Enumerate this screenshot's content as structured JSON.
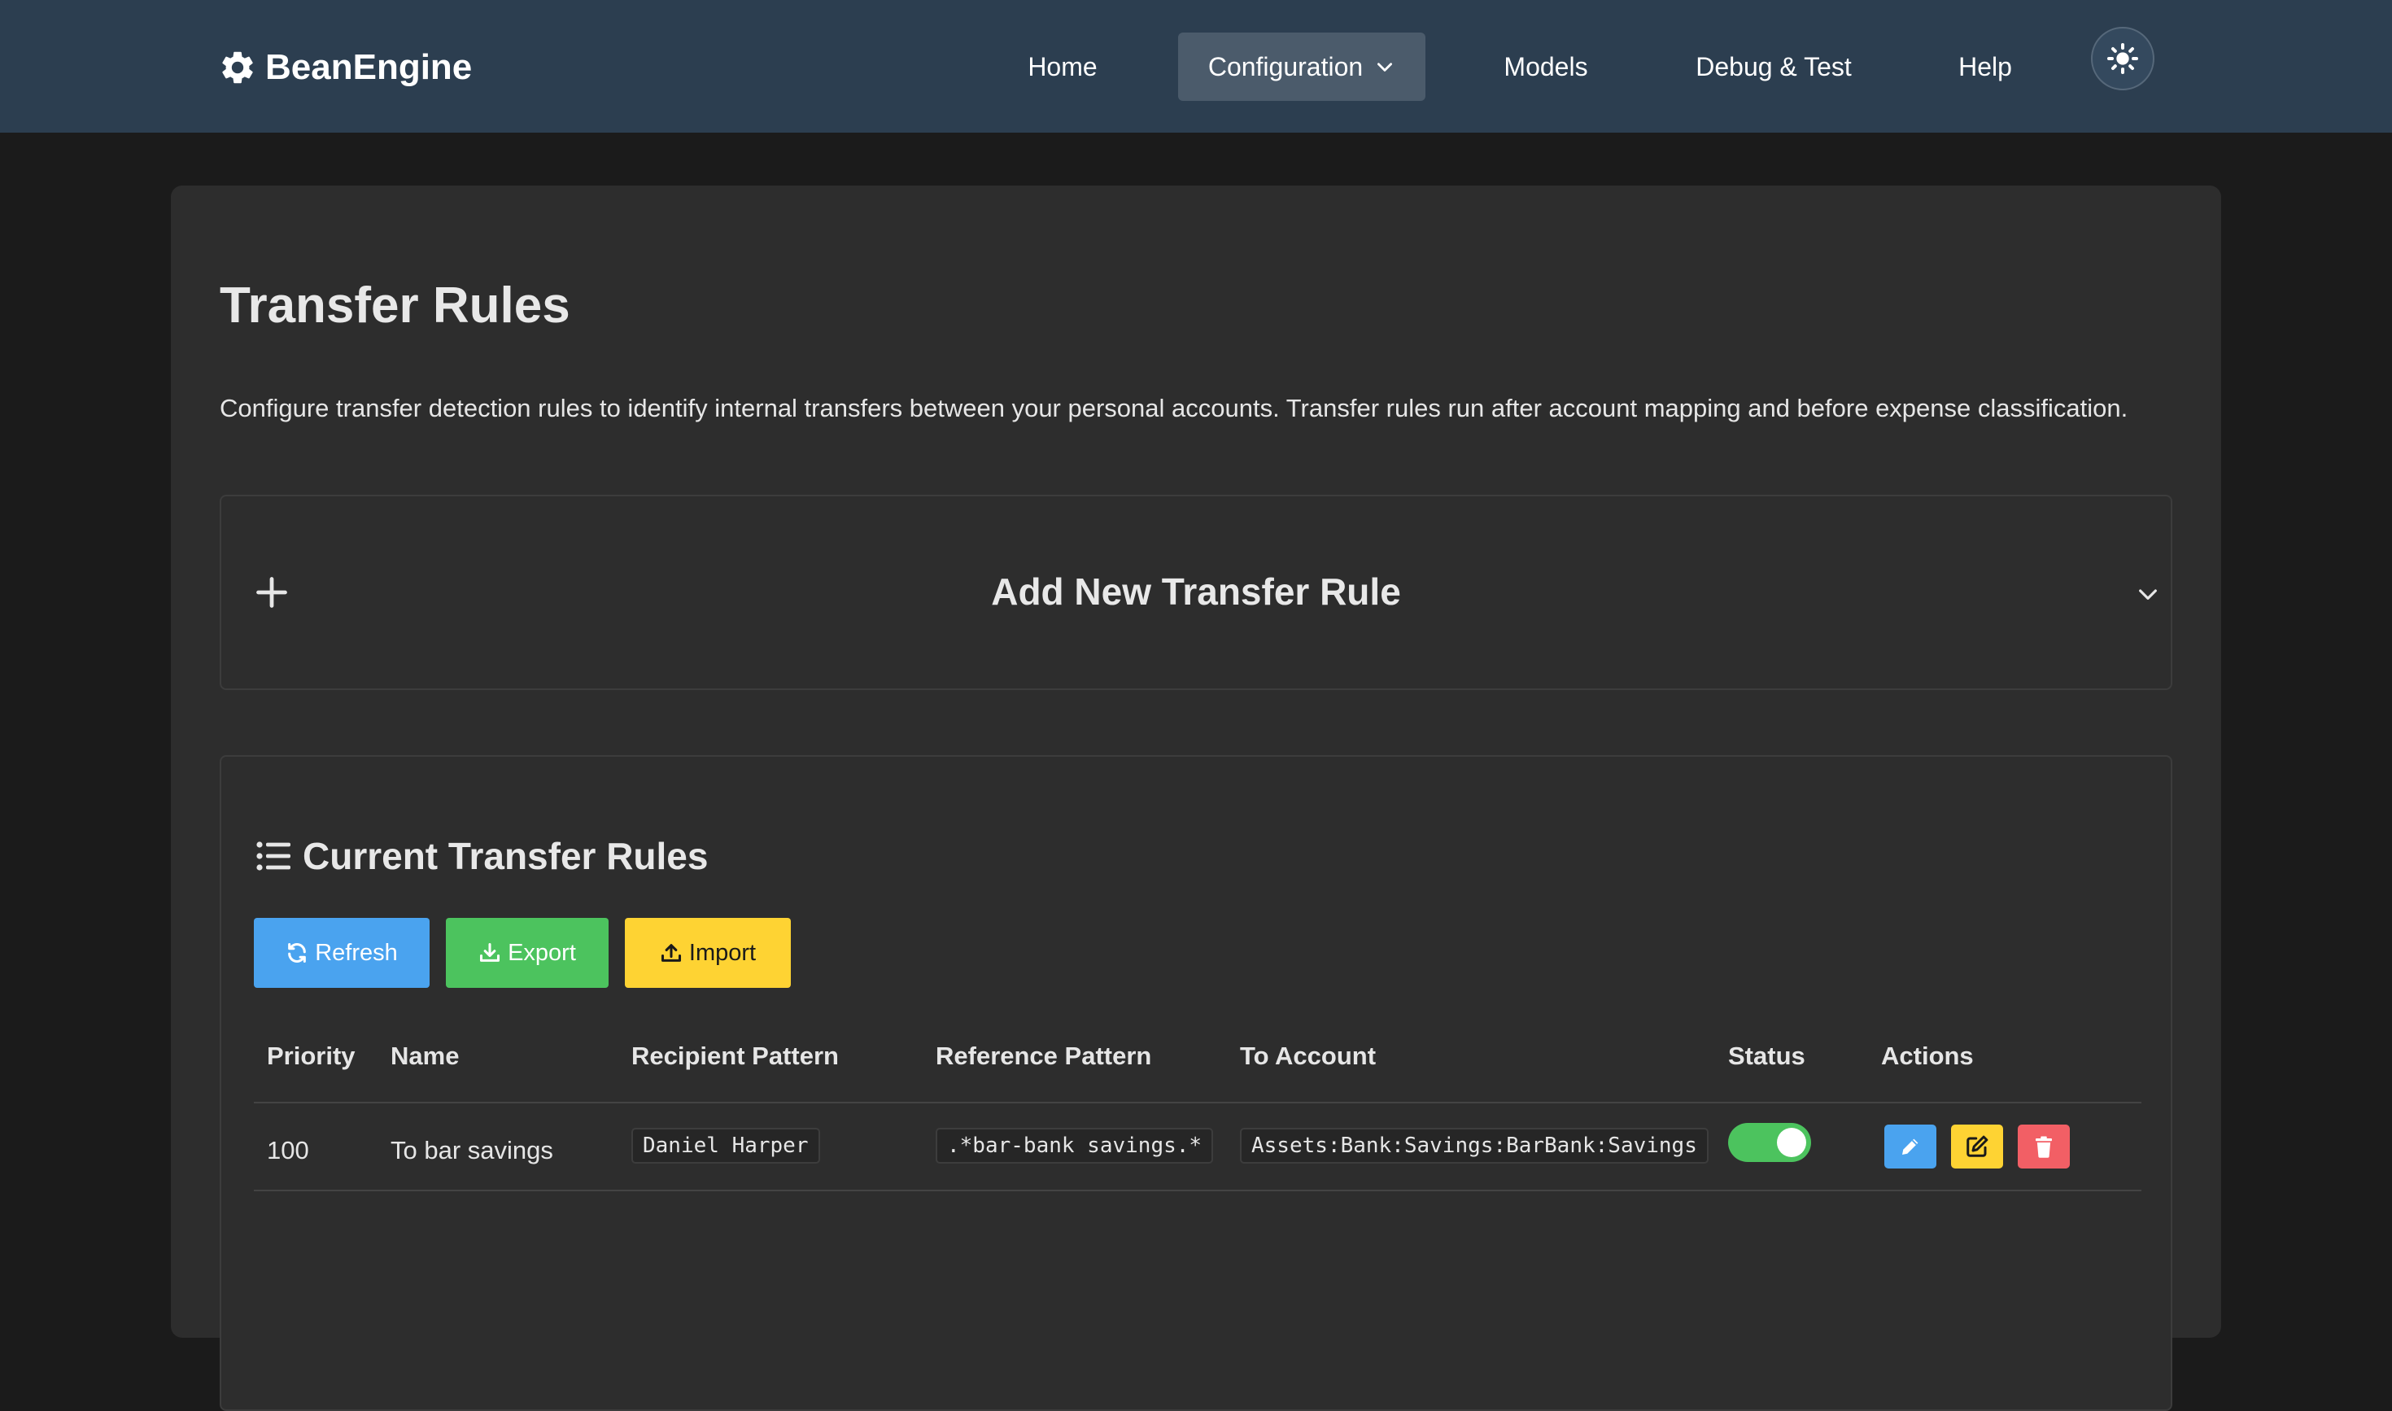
{
  "brand": {
    "name": "BeanEngine",
    "icon": "gear-icon"
  },
  "nav": {
    "items": [
      {
        "label": "Home"
      },
      {
        "label": "Configuration",
        "active": true,
        "dropdown": true
      },
      {
        "label": "Models"
      },
      {
        "label": "Debug & Test"
      },
      {
        "label": "Help"
      }
    ],
    "theme_toggle_icon": "sun-icon"
  },
  "page": {
    "title": "Transfer Rules",
    "description": "Configure transfer detection rules to identify internal transfers between your personal accounts. Transfer rules run after account mapping and before expense classification."
  },
  "add_panel": {
    "title": "Add New Transfer Rule",
    "expanded": false
  },
  "rules": {
    "title": "Current Transfer Rules",
    "buttons": {
      "refresh": "Refresh",
      "export": "Export",
      "import": "Import"
    },
    "columns": [
      "Priority",
      "Name",
      "Recipient Pattern",
      "Reference Pattern",
      "To Account",
      "Status",
      "Actions"
    ],
    "rows": [
      {
        "priority": "100",
        "name": "To bar savings",
        "recipient_pattern": "Daniel Harper",
        "reference_pattern": ".*bar-bank savings.*",
        "to_account": "Assets:Bank:Savings:BarBank:Savings",
        "enabled": true
      }
    ]
  },
  "colors": {
    "navbar": "#2c3e50",
    "card": "#2d2d2d",
    "page_bg": "#1b1b1b",
    "primary": "#4aa3ef",
    "success": "#4cc35e",
    "warning": "#fed333",
    "danger": "#f25f65"
  }
}
